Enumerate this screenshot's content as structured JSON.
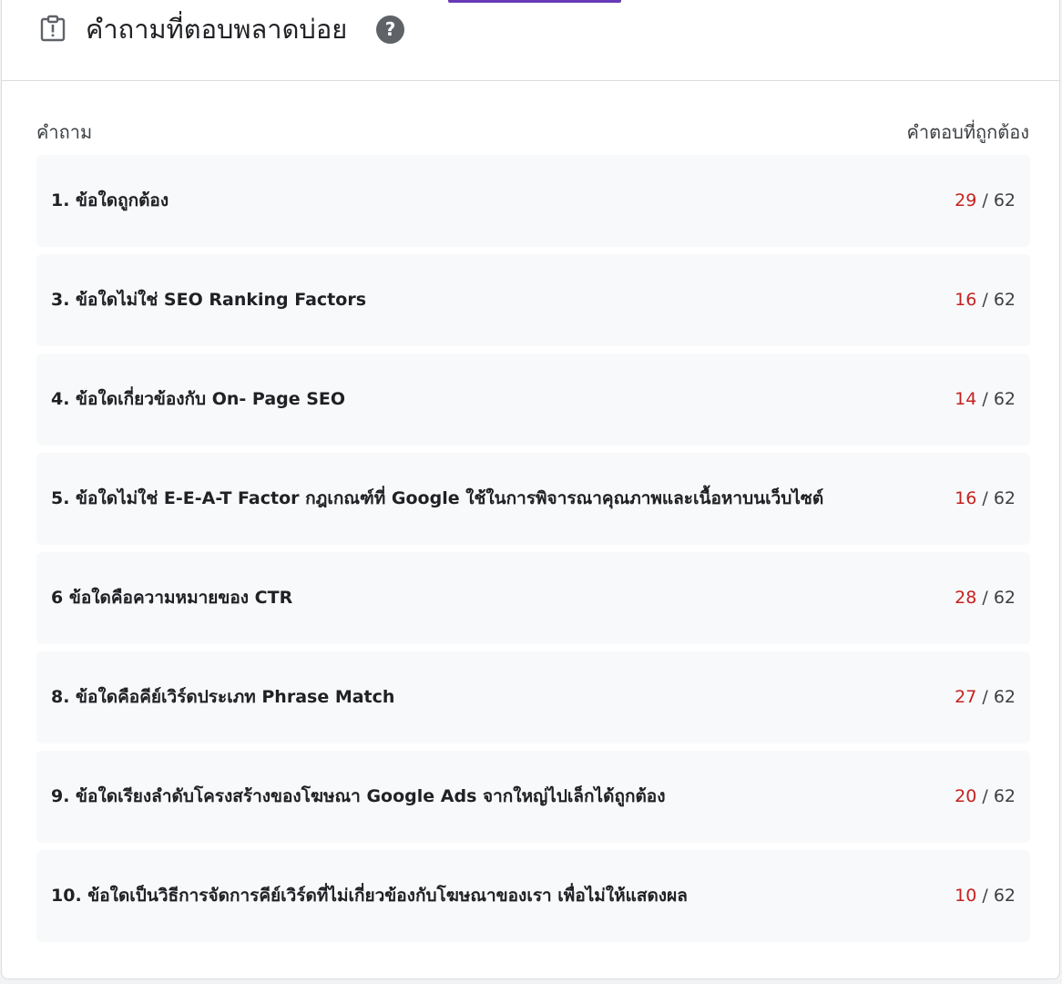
{
  "header": {
    "title": "คำถามที่ตอบพลาดบ่อย",
    "help_icon": "help-circle-icon",
    "section_icon": "clipboard-alert-icon",
    "help_glyph": "?"
  },
  "columns": {
    "question": "คำถาม",
    "correct_answers": "คำตอบที่ถูกต้อง"
  },
  "colors": {
    "accent": "#673ab7",
    "correct_count": "#c5221f",
    "row_background": "#f8f9fa"
  },
  "rows": [
    {
      "question": "1. ข้อใดถูกต้อง",
      "correct": "29",
      "separator": " / ",
      "total": "62"
    },
    {
      "question": "3. ข้อใดไม่ใช่ SEO Ranking Factors",
      "correct": "16",
      "separator": " / ",
      "total": "62"
    },
    {
      "question": "4. ข้อใดเกี่ยวข้องกับ On- Page SEO",
      "correct": "14",
      "separator": " / ",
      "total": "62"
    },
    {
      "question": "5. ข้อใดไม่ใช่ E-E-A-T Factor กฎเกณฑ์ที่ Google ใช้ในการพิจารณาคุณภาพและเนื้อหาบนเว็บไซต์",
      "correct": "16",
      "separator": " / ",
      "total": "62"
    },
    {
      "question": "6 ข้อใดคือความหมายของ CTR",
      "correct": "28",
      "separator": " / ",
      "total": "62"
    },
    {
      "question": "8. ข้อใดคือคีย์เวิร์ดประเภท Phrase Match",
      "correct": "27",
      "separator": " / ",
      "total": "62"
    },
    {
      "question": "9. ข้อใดเรียงลำดับโครงสร้างของโฆษณา Google Ads จากใหญ่ไปเล็กได้ถูกต้อง",
      "correct": "20",
      "separator": " / ",
      "total": "62"
    },
    {
      "question": "10. ข้อใดเป็นวิธีการจัดการคีย์เวิร์ดที่ไม่เกี่ยวข้องกับโฆษณาของเรา เพื่อไม่ให้แสดงผล",
      "correct": "10",
      "separator": " / ",
      "total": "62"
    }
  ]
}
